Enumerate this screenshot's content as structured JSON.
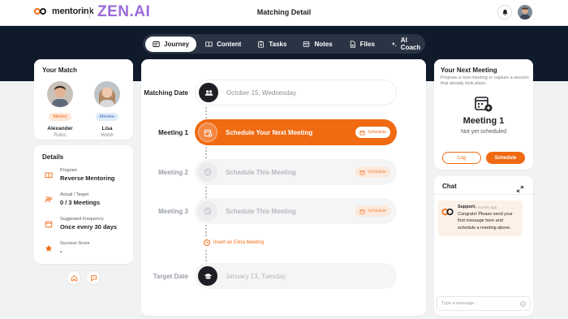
{
  "header": {
    "brand": "mentorink",
    "product": "ZEN.AI",
    "title": "Matching Detail",
    "icons": {
      "bell": "bell-icon",
      "avatar": "user-avatar"
    }
  },
  "tabs": [
    {
      "label": "Journey",
      "icon": "journey-icon",
      "active": true
    },
    {
      "label": "Content",
      "icon": "book-icon",
      "active": false
    },
    {
      "label": "Tasks",
      "icon": "clipboard-icon",
      "active": false
    },
    {
      "label": "Notes",
      "icon": "notes-icon",
      "active": false
    },
    {
      "label": "Files",
      "icon": "file-icon",
      "active": false
    },
    {
      "label": "AI Coach",
      "icon": "sparkle-icon",
      "active": false
    }
  ],
  "match": {
    "title": "Your Match",
    "mentor": {
      "role": "Mentor",
      "first": "Alexander",
      "last": "Rubic"
    },
    "mentee": {
      "role": "Mentee",
      "first": "Lisa",
      "last": "Webb"
    }
  },
  "details": {
    "title": "Details",
    "items": [
      {
        "label": "Program",
        "value": "Reverse Mentoring",
        "icon": "book-icon"
      },
      {
        "label": "Actual / Target",
        "value": "0 / 3 Meetings",
        "icon": "people-icon"
      },
      {
        "label": "Suggested Frequency",
        "value": "Once every 30 days",
        "icon": "calendar-icon"
      },
      {
        "label": "Success Score",
        "value": "-",
        "icon": "star-icon"
      }
    ]
  },
  "journey": {
    "matching": {
      "label": "Matching Date",
      "date": "October 15, Wednesday"
    },
    "meeting1": {
      "label": "Meeting 1",
      "text": "Schedule Your Next Meeting",
      "chip": "Schedule"
    },
    "meeting2": {
      "label": "Meeting 2",
      "text": "Schedule This Meeting",
      "chip": "Schedule"
    },
    "meeting3": {
      "label": "Meeting 3",
      "text": "Schedule This Meeting",
      "chip": "Schedule"
    },
    "insert": "Insert an Extra Meeting",
    "target": {
      "label": "Target Date",
      "date": "January 13, Tuesday"
    }
  },
  "next_meeting": {
    "title": "Your Next Meeting",
    "subtitle": "Propose a new meeting or capture a session that already took place.",
    "meeting": "Meeting 1",
    "status": "Not yet scheduled",
    "log_label": "Log",
    "schedule_label": "Schedule"
  },
  "chat": {
    "title": "Chat",
    "message": {
      "author": "Support",
      "time": "5 months ago",
      "text": "Congrats! Please send your first message here and schedule a meeting above."
    },
    "placeholder": "Type a message..."
  },
  "colors": {
    "accent": "#f06a12",
    "navy": "#0f1a2a",
    "brand_purple": "#9a6bd9"
  }
}
